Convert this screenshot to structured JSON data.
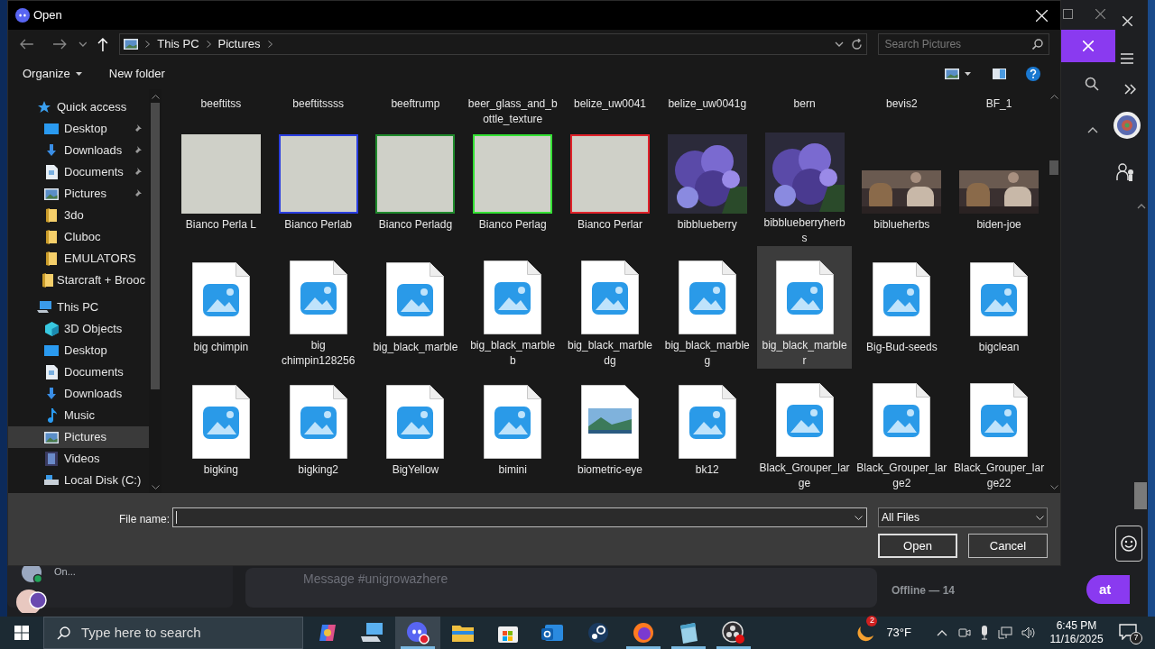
{
  "dialog": {
    "title": "Open",
    "breadcrumb": [
      "This PC",
      "Pictures"
    ],
    "search_placeholder": "Search Pictures",
    "toolbar": [
      "Organize",
      "New folder"
    ],
    "nav": [
      {
        "label": "Quick access",
        "kind": "star",
        "pinned": false,
        "selected": false,
        "children": [
          {
            "label": "Desktop",
            "kind": "desktop",
            "pinned": true,
            "selected": false
          },
          {
            "label": "Downloads",
            "kind": "download",
            "pinned": true,
            "selected": false
          },
          {
            "label": "Documents",
            "kind": "document",
            "pinned": true,
            "selected": false
          },
          {
            "label": "Pictures",
            "kind": "pictures",
            "pinned": true,
            "selected": false
          },
          {
            "label": "3do",
            "kind": "folder",
            "pinned": false,
            "selected": false
          },
          {
            "label": "Cluboc",
            "kind": "folder",
            "pinned": false,
            "selected": false
          },
          {
            "label": "EMULATORS",
            "kind": "folder",
            "pinned": false,
            "selected": false
          },
          {
            "label": "Starcraft + Brooc",
            "kind": "folder",
            "pinned": false,
            "selected": false
          }
        ]
      },
      {
        "label": "This PC",
        "kind": "pc",
        "pinned": false,
        "selected": false,
        "children": [
          {
            "label": "3D Objects",
            "kind": "cube",
            "pinned": false,
            "selected": false
          },
          {
            "label": "Desktop",
            "kind": "desktop",
            "pinned": false,
            "selected": false
          },
          {
            "label": "Documents",
            "kind": "document",
            "pinned": false,
            "selected": false
          },
          {
            "label": "Downloads",
            "kind": "download",
            "pinned": false,
            "selected": false
          },
          {
            "label": "Music",
            "kind": "music",
            "pinned": false,
            "selected": false
          },
          {
            "label": "Pictures",
            "kind": "pictures",
            "pinned": false,
            "selected": true
          },
          {
            "label": "Videos",
            "kind": "video",
            "pinned": false,
            "selected": false
          },
          {
            "label": "Local Disk (C:)",
            "kind": "disk",
            "pinned": false,
            "selected": false
          }
        ]
      }
    ],
    "files": [
      {
        "name": "beeftitss",
        "kind": "label",
        "hovered": false
      },
      {
        "name": "beeftitssss",
        "kind": "label",
        "hovered": false
      },
      {
        "name": "beeftrump",
        "kind": "label",
        "hovered": false
      },
      {
        "name": "beer_glass_and_b\nottle_texture",
        "kind": "label",
        "hovered": false
      },
      {
        "name": "belize_uw0041",
        "kind": "label",
        "hovered": false
      },
      {
        "name": "belize_uw0041g",
        "kind": "label",
        "hovered": false
      },
      {
        "name": "bern",
        "kind": "label",
        "hovered": false
      },
      {
        "name": "bevis2",
        "kind": "label",
        "hovered": false
      },
      {
        "name": "BF_1",
        "kind": "label",
        "hovered": false
      },
      {
        "name": "Bianco Perla L",
        "kind": "texture",
        "hovered": false
      },
      {
        "name": "Bianco Perlab",
        "kind": "texture",
        "color": "#2a3ee0",
        "hovered": false
      },
      {
        "name": "Bianco Perladg",
        "kind": "texture",
        "color": "#1f8a2c",
        "hovered": false
      },
      {
        "name": "Bianco Perlag",
        "kind": "texture",
        "color": "#34e034",
        "hovered": false
      },
      {
        "name": "Bianco Perlar",
        "kind": "texture",
        "color": "#e0222a",
        "hovered": false
      },
      {
        "name": "bibblueberry",
        "hovered": false
      },
      {
        "name": "bibblueberryherb\ns",
        "hovered": false
      },
      {
        "name": "biblueherbs",
        "kind": "video",
        "hovered": false
      },
      {
        "name": "biden-joe",
        "kind": "video",
        "hovered": false
      },
      {
        "name": "big chimpin",
        "kind": "image-file",
        "hovered": false
      },
      {
        "name": "big\nchimpin128256",
        "kind": "image-file",
        "hovered": false
      },
      {
        "name": "big_black_marble",
        "kind": "image-file",
        "hovered": false
      },
      {
        "name": "big_black_marble\nb",
        "kind": "image-file",
        "hovered": false
      },
      {
        "name": "big_black_marble\ndg",
        "kind": "image-file",
        "hovered": false
      },
      {
        "name": "big_black_marble\ng",
        "kind": "image-file",
        "hovered": false
      },
      {
        "name": "big_black_marble\nr",
        "kind": "image-file",
        "hovered": true
      },
      {
        "name": "Big-Bud-seeds",
        "kind": "image-file",
        "hovered": false
      },
      {
        "name": "bigclean",
        "kind": "image-file",
        "hovered": false
      },
      {
        "name": "bigking",
        "kind": "image-file",
        "hovered": false
      },
      {
        "name": "bigking2",
        "kind": "image-file",
        "hovered": false
      },
      {
        "name": "BigYellow",
        "kind": "image-file",
        "hovered": false
      },
      {
        "name": "bimini",
        "kind": "image-file",
        "hovered": false
      },
      {
        "name": "biometric-eye",
        "kind": "photo-file",
        "hovered": false
      },
      {
        "name": "bk12",
        "kind": "image-file",
        "hovered": false
      },
      {
        "name": "Black_Grouper_lar\nge",
        "kind": "image-file",
        "hovered": false
      },
      {
        "name": "Black_Grouper_lar\nge2",
        "kind": "image-file",
        "hovered": false
      },
      {
        "name": "Black_Grouper_lar\nge22",
        "kind": "image-file",
        "hovered": false
      }
    ],
    "file_name_label": "File name:",
    "file_type": "All Files",
    "buttons": [
      "Open",
      "Cancel"
    ]
  },
  "background": {
    "user_status": "On...",
    "message_placeholder": "Message #unigrowazhere",
    "members_heading": "Offline — 14",
    "chat_button": "at"
  },
  "taskbar": {
    "search_placeholder": "Type here to search",
    "apps": [
      {
        "kind": "copilot",
        "running": false
      },
      {
        "kind": "pc",
        "running": false
      },
      {
        "kind": "discord",
        "running": true
      },
      {
        "kind": "explorer",
        "running": false
      },
      {
        "kind": "store",
        "running": false
      },
      {
        "kind": "mail",
        "running": false
      },
      {
        "kind": "steam",
        "running": false
      },
      {
        "kind": "firefox",
        "running": true
      },
      {
        "kind": "notepad",
        "running": true
      },
      {
        "kind": "obs",
        "running": true
      }
    ],
    "weather_badge": "2",
    "temperature": "73°F",
    "time": "6:45 PM",
    "date": "11/16/2025",
    "notification_count": "7"
  }
}
